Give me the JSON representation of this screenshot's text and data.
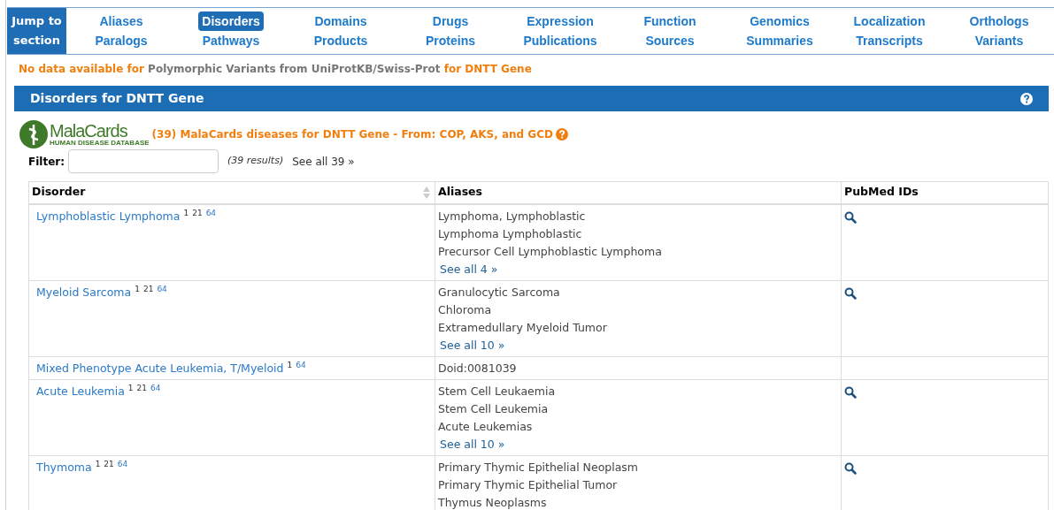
{
  "jump_label": "Jump to section",
  "nav": [
    {
      "top": {
        "label": "Aliases",
        "selected": false
      },
      "bottom": {
        "label": "Paralogs",
        "selected": false
      }
    },
    {
      "top": {
        "label": "Disorders",
        "selected": true
      },
      "bottom": {
        "label": "Pathways",
        "selected": false
      }
    },
    {
      "top": {
        "label": "Domains",
        "selected": false
      },
      "bottom": {
        "label": "Products",
        "selected": false
      }
    },
    {
      "top": {
        "label": "Drugs",
        "selected": false
      },
      "bottom": {
        "label": "Proteins",
        "selected": false
      }
    },
    {
      "top": {
        "label": "Expression",
        "selected": false
      },
      "bottom": {
        "label": "Publications",
        "selected": false
      }
    },
    {
      "top": {
        "label": "Function",
        "selected": false
      },
      "bottom": {
        "label": "Sources",
        "selected": false
      }
    },
    {
      "top": {
        "label": "Genomics",
        "selected": false
      },
      "bottom": {
        "label": "Summaries",
        "selected": false
      }
    },
    {
      "top": {
        "label": "Localization",
        "selected": false
      },
      "bottom": {
        "label": "Transcripts",
        "selected": false
      }
    },
    {
      "top": {
        "label": "Orthologs",
        "selected": false
      },
      "bottom": {
        "label": "Variants",
        "selected": false
      }
    }
  ],
  "notice": [
    {
      "text": "No data available for",
      "kind": "accent"
    },
    {
      "text": "Polymorphic Variants from UniProtKB/Swiss-Prot",
      "kind": "muted"
    },
    {
      "text": "for DNTT Gene",
      "kind": "accent"
    }
  ],
  "section": {
    "title": "Disorders for DNTT Gene",
    "logo": {
      "name": "MalaCards",
      "tagline": "HUMAN DISEASE DATABASE"
    },
    "summary": "(39) MalaCards diseases for DNTT Gene - From: COP, AKS, and GCD",
    "filter": {
      "label": "Filter:",
      "count": "(39 results)",
      "see_all": "See all 39 »"
    },
    "table": {
      "columns": [
        "Disorder",
        "Aliases",
        "PubMed IDs"
      ],
      "rows": [
        {
          "disorder": {
            "name": "Lymphoblastic Lymphoma",
            "sources": [
              {
                "text": "1",
                "kind": "plain"
              },
              {
                "text": "21",
                "kind": "plain"
              },
              {
                "text": "64",
                "kind": "link"
              }
            ]
          },
          "aliases": [
            "Lymphoma, Lymphoblastic",
            "Lymphoma Lymphoblastic",
            "Precursor Cell Lymphoblastic Lymphoma"
          ],
          "see_all": "See all 4 »",
          "pubmed": true
        },
        {
          "disorder": {
            "name": "Myeloid Sarcoma",
            "sources": [
              {
                "text": "1",
                "kind": "plain"
              },
              {
                "text": "21",
                "kind": "plain"
              },
              {
                "text": "64",
                "kind": "link"
              }
            ]
          },
          "aliases": [
            "Granulocytic Sarcoma",
            "Chloroma",
            "Extramedullary Myeloid Tumor"
          ],
          "see_all": "See all 10 »",
          "pubmed": true
        },
        {
          "disorder": {
            "name": "Mixed Phenotype Acute Leukemia, T/Myeloid",
            "sources": [
              {
                "text": "1",
                "kind": "plain"
              },
              {
                "text": "64",
                "kind": "link"
              }
            ]
          },
          "aliases": [
            "Doid:0081039"
          ],
          "pubmed": false
        },
        {
          "disorder": {
            "name": "Acute Leukemia",
            "sources": [
              {
                "text": "1",
                "kind": "plain"
              },
              {
                "text": "21",
                "kind": "plain"
              },
              {
                "text": "64",
                "kind": "link"
              }
            ]
          },
          "aliases": [
            "Stem Cell Leukaemia",
            "Stem Cell Leukemia",
            "Acute Leukemias"
          ],
          "see_all": "See all 10 »",
          "pubmed": true
        },
        {
          "disorder": {
            "name": "Thymoma",
            "sources": [
              {
                "text": "1",
                "kind": "plain"
              },
              {
                "text": "21",
                "kind": "plain"
              },
              {
                "text": "64",
                "kind": "link"
              }
            ]
          },
          "aliases": [
            "Primary Thymic Epithelial Neoplasm",
            "Primary Thymic Epithelial Tumor",
            "Thymus Neoplasms"
          ],
          "pubmed": true
        }
      ]
    }
  }
}
